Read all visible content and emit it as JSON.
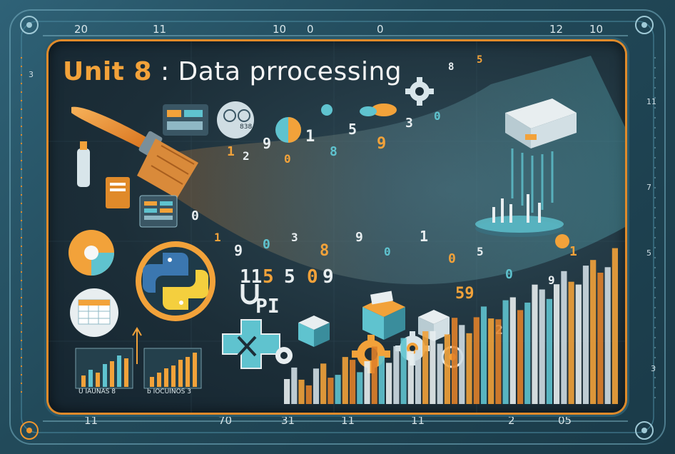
{
  "title": {
    "unit": "Unit 8",
    "separator": ":",
    "text": "Data prrocessing"
  },
  "ruler": {
    "top": [
      "20",
      "11",
      "10",
      "0",
      "0",
      "12",
      "10"
    ],
    "bottom": [
      "11",
      "70",
      "31",
      "11",
      "11",
      "2",
      "05"
    ],
    "left": [
      "3"
    ],
    "right": [
      "11",
      "7",
      "5",
      "3"
    ]
  },
  "chart_labels": {
    "left": "U IAUNAS 8",
    "right": "b IOCUINOS 3",
    "badge": "838"
  },
  "colors": {
    "accent": "#f2a23a",
    "teal": "#5fc3cf",
    "frame": "#2b5a6c",
    "panel": "#1c2e38"
  },
  "icons": [
    "paintbrush-icon",
    "python-logo-icon",
    "gear-icon",
    "server-icon",
    "bar-chart-icon",
    "spreadsheet-icon",
    "magnet-icon",
    "cloud-icon",
    "cube-icon",
    "plus-icon"
  ]
}
